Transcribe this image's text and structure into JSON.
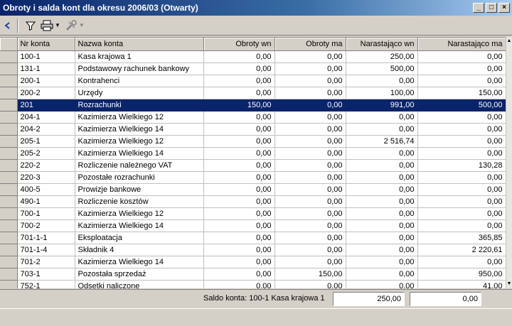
{
  "window": {
    "title": "Obroty i salda kont dla okresu 2006/03 (Otwarty)",
    "buttons": [
      "minimize-icon",
      "maximize-icon",
      "close-icon"
    ]
  },
  "toolbar": {
    "icons": [
      "back-arrow-icon",
      "filter-icon",
      "printer-icon",
      "tools-icon"
    ]
  },
  "table": {
    "columns": [
      "Nr konta",
      "Nazwa konta",
      "Obroty wn",
      "Obroty ma",
      "Narastająco wn",
      "Narastająco ma"
    ],
    "selected_index": 4,
    "rows": [
      [
        "100-1",
        "Kasa krajowa 1",
        "0,00",
        "0,00",
        "250,00",
        "0,00"
      ],
      [
        "131-1",
        "Podstawowy rachunek bankowy",
        "0,00",
        "0,00",
        "500,00",
        "0,00"
      ],
      [
        "200-1",
        "Kontrahenci",
        "0,00",
        "0,00",
        "0,00",
        "0,00"
      ],
      [
        "200-2",
        "Urzędy",
        "0,00",
        "0,00",
        "100,00",
        "150,00"
      ],
      [
        "201",
        "Rozrachunki",
        "150,00",
        "0,00",
        "991,00",
        "500,00"
      ],
      [
        "204-1",
        "Kazimierza Wielkiego 12",
        "0,00",
        "0,00",
        "0,00",
        "0,00"
      ],
      [
        "204-2",
        "Kazimierza Wielkiego 14",
        "0,00",
        "0,00",
        "0,00",
        "0,00"
      ],
      [
        "205-1",
        "Kazimierza Wielkiego 12",
        "0,00",
        "0,00",
        "2 516,74",
        "0,00"
      ],
      [
        "205-2",
        "Kazimierza Wielkiego 14",
        "0,00",
        "0,00",
        "0,00",
        "0,00"
      ],
      [
        "220-2",
        "Rozliczenie należnego VAT",
        "0,00",
        "0,00",
        "0,00",
        "130,28"
      ],
      [
        "220-3",
        "Pozostałe rozrachunki",
        "0,00",
        "0,00",
        "0,00",
        "0,00"
      ],
      [
        "400-5",
        "Prowizje bankowe",
        "0,00",
        "0,00",
        "0,00",
        "0,00"
      ],
      [
        "490-1",
        "Rozliczenie kosztów",
        "0,00",
        "0,00",
        "0,00",
        "0,00"
      ],
      [
        "700-1",
        "Kazimierza Wielkiego 12",
        "0,00",
        "0,00",
        "0,00",
        "0,00"
      ],
      [
        "700-2",
        "Kazimierza Wielkiego 14",
        "0,00",
        "0,00",
        "0,00",
        "0,00"
      ],
      [
        "701-1-1",
        "Eksploatacja",
        "0,00",
        "0,00",
        "0,00",
        "365,85"
      ],
      [
        "701-1-4",
        "Składnik 4",
        "0,00",
        "0,00",
        "0,00",
        "2 220,61"
      ],
      [
        "701-2",
        "Kazimierza Wielkiego 14",
        "0,00",
        "0,00",
        "0,00",
        "0,00"
      ],
      [
        "703-1",
        "Pozostała sprzedaż",
        "0,00",
        "150,00",
        "0,00",
        "950,00"
      ],
      [
        "752-1",
        "Odsetki naliczone",
        "0,00",
        "0,00",
        "0,00",
        "41,00"
      ]
    ]
  },
  "status": {
    "saldo_label": "Saldo konta: 100-1 Kasa krajowa 1",
    "saldo_wn": "250,00",
    "saldo_ma": "0,00"
  }
}
